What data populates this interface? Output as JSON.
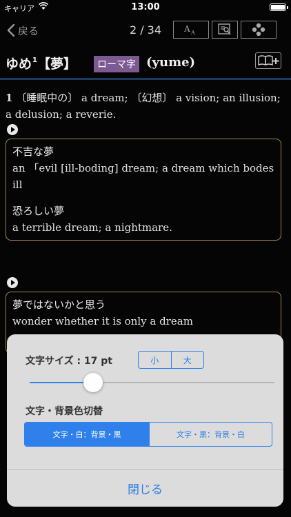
{
  "status_bar": {
    "carrier": "キャリア",
    "time": "13:00"
  },
  "nav": {
    "back_label": "戻る",
    "page_counter": "2 / 34",
    "tools": [
      "font-size-icon",
      "search-document-icon",
      "dpad-icon"
    ]
  },
  "entry": {
    "headword": "ゆめ",
    "headword_superscript": "1",
    "kanji": "【夢】",
    "romaji_badge": "ローマ字",
    "romaji": "(yume)",
    "sense_number": "1",
    "sense_text": "〔睡眠中の〕 a dream; 〔幻想〕 a vision; an illusion; a delusion; a reverie.",
    "examples": [
      {
        "jp": "不吉な夢",
        "en": "an 「evil [ill-boding] dream; a dream which bodes ill"
      },
      {
        "jp": "恐ろしい夢",
        "en": "a terrible dream; a nightmare."
      },
      {
        "jp": "夢ではないかと思う",
        "en": "wonder whether it is only a dream"
      }
    ]
  },
  "settings": {
    "font_size_label": "文字サイズ : 17 pt",
    "size_small": "小",
    "size_large": "大",
    "slider_value": 0.26,
    "color_label": "文字・背景色切替",
    "color_option_1": "文字・白：背景・黒",
    "color_option_2": "文字・黒：背景・白",
    "close_label": "閉じる",
    "accent_color": "#2f80ea",
    "badge_color": "#7e5a93"
  }
}
